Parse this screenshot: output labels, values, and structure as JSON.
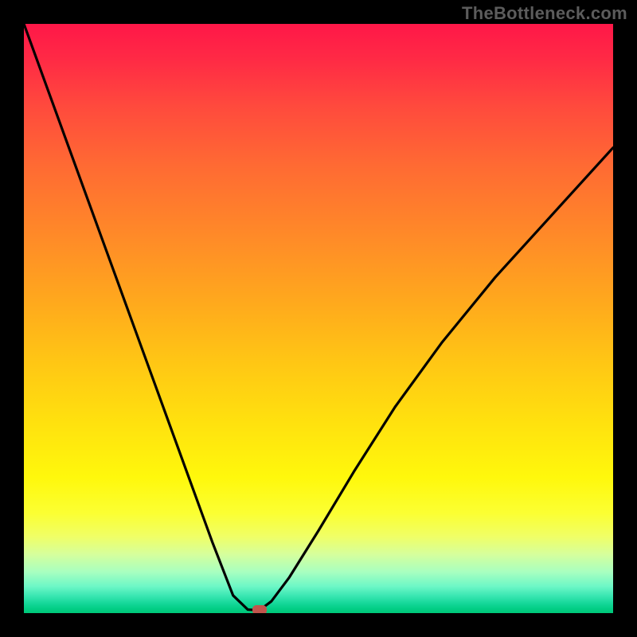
{
  "watermark": "TheBottleneck.com",
  "chart_data": {
    "type": "line",
    "title": "",
    "xlabel": "",
    "ylabel": "",
    "xlim": [
      0,
      100
    ],
    "ylim": [
      0,
      100
    ],
    "grid": false,
    "legend": false,
    "series": [
      {
        "name": "curve",
        "color": "#000000",
        "x": [
          0,
          4,
          8,
          12,
          16,
          20,
          24,
          28,
          32,
          35.5,
          38,
          39.5,
          40,
          42,
          45,
          50,
          56,
          63,
          71,
          80,
          90,
          100
        ],
        "y": [
          100,
          89,
          78,
          67,
          56,
          45,
          34,
          23,
          12,
          3,
          0.6,
          0.5,
          0.5,
          2,
          6,
          14,
          24,
          35,
          46,
          57,
          68,
          79
        ]
      }
    ],
    "marker": {
      "x_pct": 40,
      "y_pct": 0.5,
      "color": "#c1554c"
    },
    "background": "rainbow-vertical-gradient"
  }
}
